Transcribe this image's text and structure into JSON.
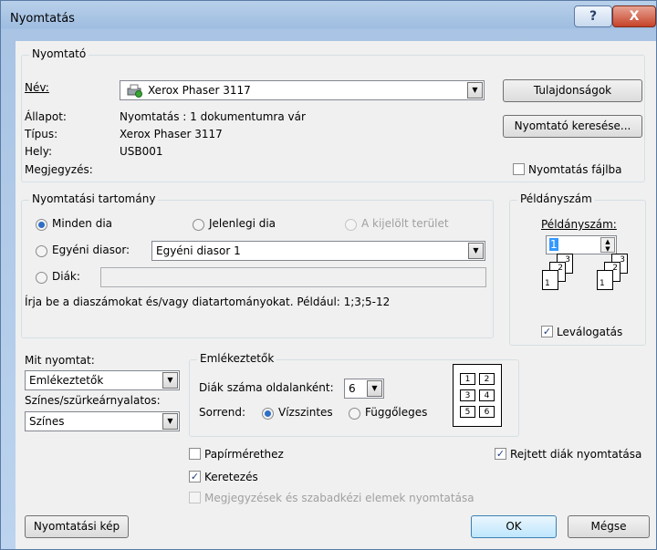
{
  "title": "Nyomtatás",
  "window_buttons": {
    "help": "?",
    "close": "X"
  },
  "printer": {
    "legend": "Nyomtató",
    "name_label": "Név:",
    "name_value": "Xerox Phaser 3117",
    "status_label": "Állapot:",
    "status_value": "Nyomtatás : 1 dokumentumra vár",
    "type_label": "Típus:",
    "type_value": "Xerox Phaser 3117",
    "where_label": "Hely:",
    "where_value": "USB001",
    "comment_label": "Megjegyzés:",
    "properties_button": "Tulajdonságok",
    "find_printer_button": "Nyomtató keresése...",
    "print_to_file_label": "Nyomtatás fájlba",
    "print_to_file_checked": false
  },
  "range": {
    "legend": "Nyomtatási tartomány",
    "all_slides": "Minden dia",
    "current_slide": "Jelenlegi dia",
    "selection": "A kijelölt terület",
    "custom_show": "Egyéni diasor:",
    "custom_show_value": "Egyéni diasor 1",
    "slides": "Diák:",
    "slides_value": "",
    "hint": "Írja be a diaszámokat és/vagy diatartományokat. Például: 1;3;5-12",
    "selected": "all_slides"
  },
  "copies": {
    "legend": "Példányszám",
    "label": "Példányszám:",
    "value": "1",
    "collate_label": "Leválogatás",
    "collate_checked": true,
    "page_numbers": [
      "1",
      "2",
      "3"
    ]
  },
  "print_what": {
    "label": "Mit nyomtat:",
    "value": "Emlékeztetők",
    "color_label": "Színes/szürkeárnyalatos:",
    "color_value": "Színes"
  },
  "handouts": {
    "legend": "Emlékeztetők",
    "per_page_label": "Diák száma oldalanként:",
    "per_page_value": "6",
    "order_label": "Sorrend:",
    "horizontal": "Vízszintes",
    "vertical": "Függőleges",
    "order_selected": "horizontal",
    "preview_numbers": [
      "1",
      "2",
      "3",
      "4",
      "5",
      "6"
    ]
  },
  "options": {
    "scale_to_fit": "Papírmérethez",
    "scale_to_fit_checked": false,
    "frame_slides": "Keretezés",
    "frame_slides_checked": true,
    "comments": "Megjegyzések és szabadkézi elemek nyomtatása",
    "comments_checked": false,
    "hidden_slides": "Rejtett diák nyomtatása",
    "hidden_slides_checked": true
  },
  "footer": {
    "preview_button": "Nyomtatási kép",
    "ok_button": "OK",
    "cancel_button": "Mégse"
  }
}
